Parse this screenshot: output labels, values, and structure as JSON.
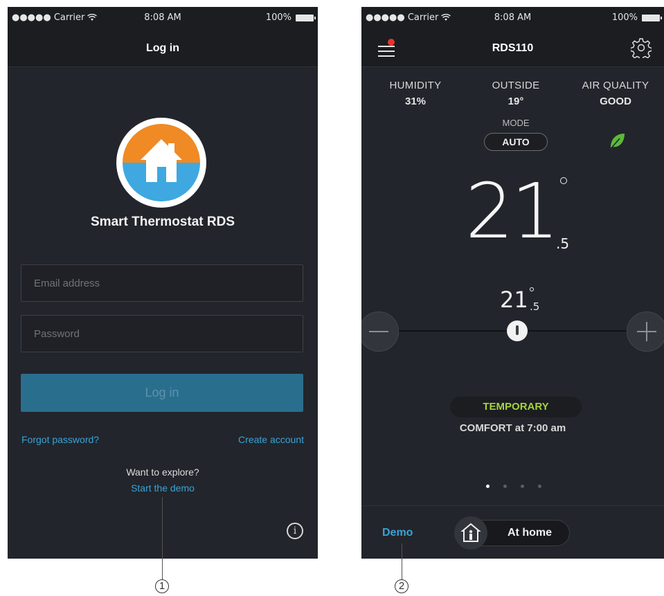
{
  "left_screen": {
    "status": {
      "carrier": "●●●●● Carrier",
      "time": "8:08 AM",
      "battery": "100%"
    },
    "nav_title": "Log in",
    "app_name": "Smart Thermostat RDS",
    "email_placeholder": "Email address",
    "password_placeholder": "Password",
    "login_button": "Log in",
    "forgot_password": "Forgot password?",
    "create_account": "Create account",
    "explore_text": "Want to explore?",
    "start_demo": "Start the demo",
    "info_icon": "i"
  },
  "right_screen": {
    "status": {
      "carrier": "●●●●● Carrier",
      "time": "8:08 AM",
      "battery": "100%"
    },
    "nav_title": "RDS110",
    "stats": {
      "humidity": {
        "label": "HUMIDITY",
        "value": "31%"
      },
      "outside": {
        "label": "OUTSIDE",
        "value": "19°"
      },
      "air_quality": {
        "label": "AIR QUALITY",
        "value": "GOOD"
      }
    },
    "mode": {
      "label": "MODE",
      "value": "AUTO"
    },
    "current_temp": {
      "whole": "21",
      "decimal": ".5"
    },
    "set_temp": {
      "whole": "21",
      "decimal": ".5"
    },
    "schedule_badge": "TEMPORARY",
    "schedule_text": "COMFORT at 7:00 am",
    "page_dots": {
      "count": 4,
      "active_index": 0
    },
    "demo_label": "Demo",
    "presence": "At home"
  },
  "callouts": [
    "1",
    "2"
  ],
  "colors": {
    "background": "#22252b",
    "accent_blue": "#3aa3d8",
    "badge_green": "#a5d33b",
    "leaf_green": "#5db93a",
    "logo_orange": "#f08a24",
    "logo_blue": "#3fa8e0",
    "notification_red": "#e8332b"
  },
  "icons": [
    "wifi-icon",
    "battery-icon",
    "house-logo-icon",
    "info-icon",
    "menu-icon",
    "gear-icon",
    "leaf-icon",
    "thermometer-icon",
    "minus-icon",
    "plus-icon",
    "person-home-icon"
  ]
}
